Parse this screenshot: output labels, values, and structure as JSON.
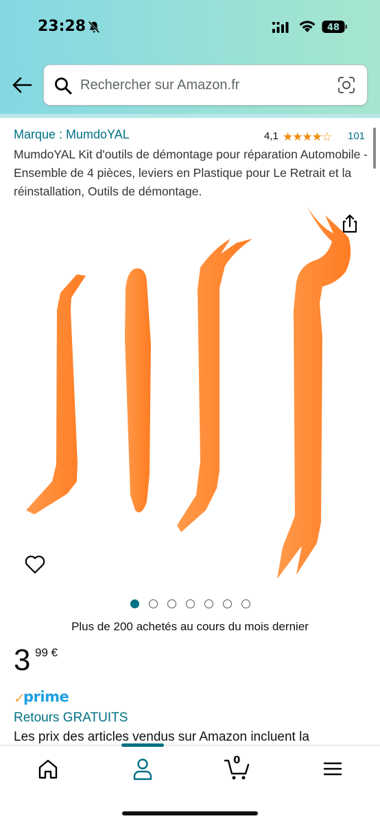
{
  "status_bar": {
    "time": "23:28",
    "battery": "48",
    "icons": [
      "bell-muted-icon",
      "signal-icon",
      "wifi-icon",
      "battery-icon"
    ]
  },
  "header": {
    "back_icon": "arrow-left-icon",
    "search_placeholder": "Rechercher sur Amazon.fr",
    "search_icon": "search-icon",
    "camera_icon": "camera-scan-icon"
  },
  "product": {
    "brand": "Marque : MumdoYAL",
    "rating_value": "4,1",
    "stars": "★★★★☆",
    "rating_count": "101",
    "title": "MumdoYAL Kit d'outils de démontage pour réparation Automobile - Ensemble de 4 pièces, leviers en Plastique pour Le Retrait et la réinstallation, Outils de démontage.",
    "image_dots_total": 7,
    "image_dot_active": 1,
    "bought": "Plus de 200 achetés au cours du mois dernier",
    "price_whole": "3",
    "price_fraction": "99 €",
    "prime_check": "✓",
    "prime_label": "prime",
    "returns": "Retours GRATUITS",
    "legal": "Les prix des articles vendus sur Amazon incluent la"
  },
  "bottom_nav": {
    "items": [
      "home-icon",
      "account-icon",
      "cart-icon",
      "menu-icon"
    ],
    "cart_count": "0",
    "active": "account"
  },
  "colors": {
    "link": "#007185",
    "star": "#f08c0b",
    "prime": "#1ea0e1",
    "tool": "#ff8c3b"
  }
}
